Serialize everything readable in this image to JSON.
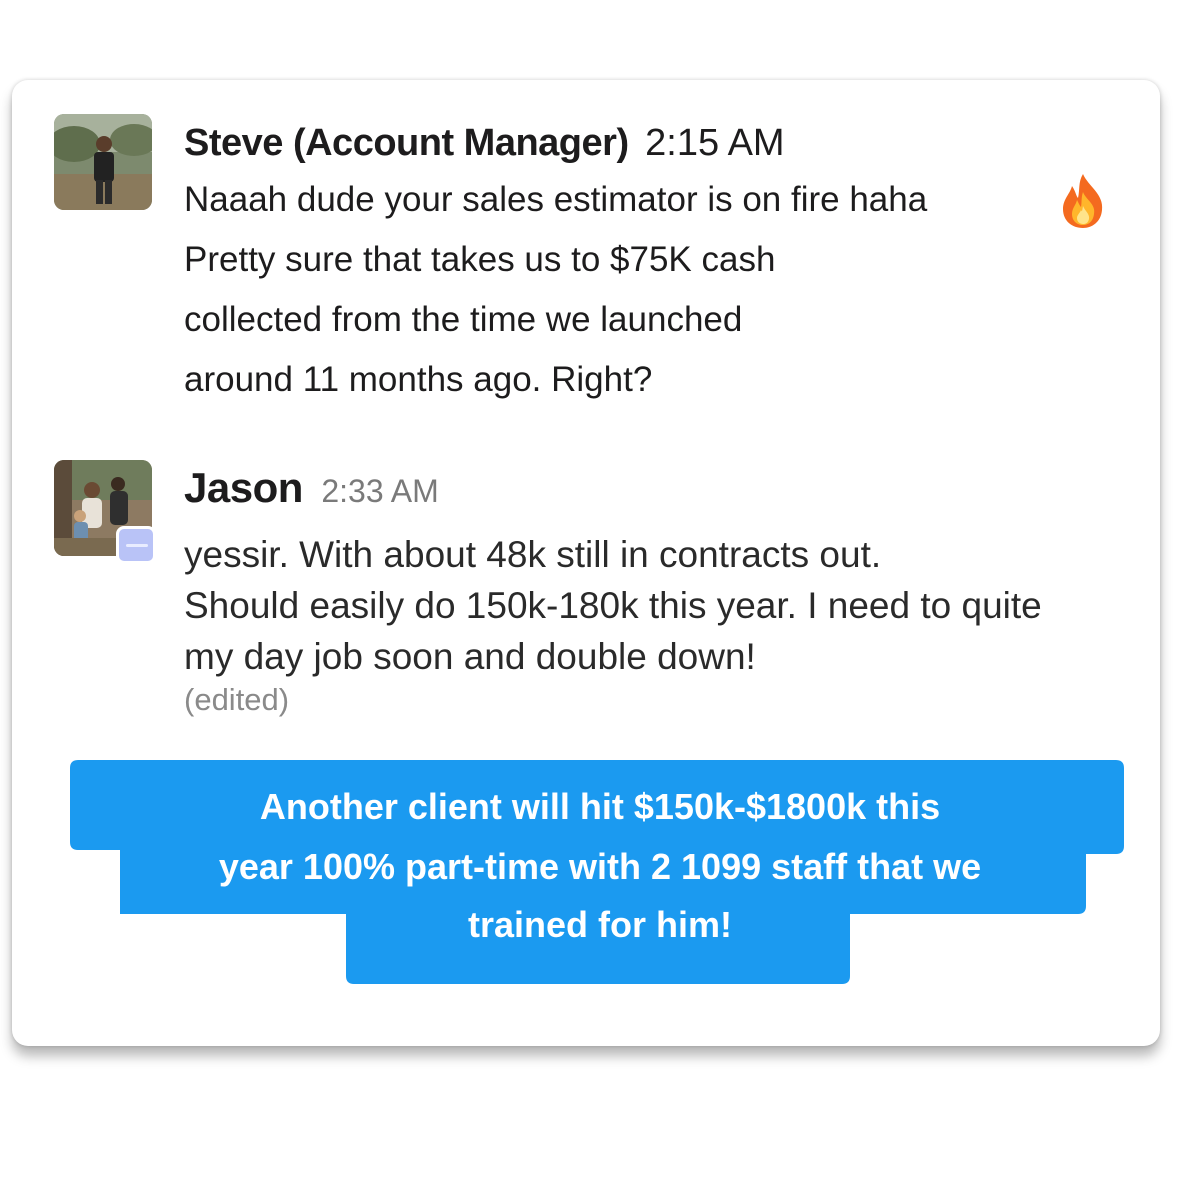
{
  "messages": [
    {
      "author": "Steve (Account Manager)",
      "time": "2:15 AM",
      "lines": [
        "Naaah dude your sales estimator is on fire haha",
        "Pretty sure that takes us to $75K cash",
        "collected from the time we launched",
        "around 11 months ago. Right?"
      ],
      "reaction_icon": "fire-emoji"
    },
    {
      "author": "Jason",
      "time": "2:33 AM",
      "lines": [
        "yessir. With about 48k still in contracts out.",
        "Should easily do 150k-180k this year. I need to quite",
        "my day job soon and double down!"
      ],
      "edited_label": "(edited)"
    }
  ],
  "callout": {
    "lines": [
      "Another client will hit $150k-$1800k this",
      "year 100% part-time with 2 1099 staff that we",
      "trained for him!"
    ],
    "color": "#1b9af0"
  }
}
